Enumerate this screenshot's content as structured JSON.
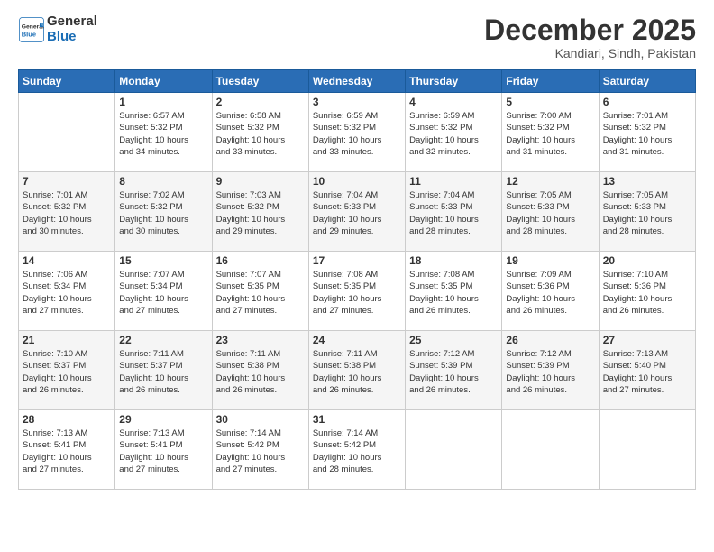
{
  "logo": {
    "line1": "General",
    "line2": "Blue"
  },
  "title": "December 2025",
  "location": "Kandiari, Sindh, Pakistan",
  "headers": [
    "Sunday",
    "Monday",
    "Tuesday",
    "Wednesday",
    "Thursday",
    "Friday",
    "Saturday"
  ],
  "weeks": [
    [
      {
        "day": "",
        "info": ""
      },
      {
        "day": "1",
        "info": "Sunrise: 6:57 AM\nSunset: 5:32 PM\nDaylight: 10 hours\nand 34 minutes."
      },
      {
        "day": "2",
        "info": "Sunrise: 6:58 AM\nSunset: 5:32 PM\nDaylight: 10 hours\nand 33 minutes."
      },
      {
        "day": "3",
        "info": "Sunrise: 6:59 AM\nSunset: 5:32 PM\nDaylight: 10 hours\nand 33 minutes."
      },
      {
        "day": "4",
        "info": "Sunrise: 6:59 AM\nSunset: 5:32 PM\nDaylight: 10 hours\nand 32 minutes."
      },
      {
        "day": "5",
        "info": "Sunrise: 7:00 AM\nSunset: 5:32 PM\nDaylight: 10 hours\nand 31 minutes."
      },
      {
        "day": "6",
        "info": "Sunrise: 7:01 AM\nSunset: 5:32 PM\nDaylight: 10 hours\nand 31 minutes."
      }
    ],
    [
      {
        "day": "7",
        "info": "Sunrise: 7:01 AM\nSunset: 5:32 PM\nDaylight: 10 hours\nand 30 minutes."
      },
      {
        "day": "8",
        "info": "Sunrise: 7:02 AM\nSunset: 5:32 PM\nDaylight: 10 hours\nand 30 minutes."
      },
      {
        "day": "9",
        "info": "Sunrise: 7:03 AM\nSunset: 5:32 PM\nDaylight: 10 hours\nand 29 minutes."
      },
      {
        "day": "10",
        "info": "Sunrise: 7:04 AM\nSunset: 5:33 PM\nDaylight: 10 hours\nand 29 minutes."
      },
      {
        "day": "11",
        "info": "Sunrise: 7:04 AM\nSunset: 5:33 PM\nDaylight: 10 hours\nand 28 minutes."
      },
      {
        "day": "12",
        "info": "Sunrise: 7:05 AM\nSunset: 5:33 PM\nDaylight: 10 hours\nand 28 minutes."
      },
      {
        "day": "13",
        "info": "Sunrise: 7:05 AM\nSunset: 5:33 PM\nDaylight: 10 hours\nand 28 minutes."
      }
    ],
    [
      {
        "day": "14",
        "info": "Sunrise: 7:06 AM\nSunset: 5:34 PM\nDaylight: 10 hours\nand 27 minutes."
      },
      {
        "day": "15",
        "info": "Sunrise: 7:07 AM\nSunset: 5:34 PM\nDaylight: 10 hours\nand 27 minutes."
      },
      {
        "day": "16",
        "info": "Sunrise: 7:07 AM\nSunset: 5:35 PM\nDaylight: 10 hours\nand 27 minutes."
      },
      {
        "day": "17",
        "info": "Sunrise: 7:08 AM\nSunset: 5:35 PM\nDaylight: 10 hours\nand 27 minutes."
      },
      {
        "day": "18",
        "info": "Sunrise: 7:08 AM\nSunset: 5:35 PM\nDaylight: 10 hours\nand 26 minutes."
      },
      {
        "day": "19",
        "info": "Sunrise: 7:09 AM\nSunset: 5:36 PM\nDaylight: 10 hours\nand 26 minutes."
      },
      {
        "day": "20",
        "info": "Sunrise: 7:10 AM\nSunset: 5:36 PM\nDaylight: 10 hours\nand 26 minutes."
      }
    ],
    [
      {
        "day": "21",
        "info": "Sunrise: 7:10 AM\nSunset: 5:37 PM\nDaylight: 10 hours\nand 26 minutes."
      },
      {
        "day": "22",
        "info": "Sunrise: 7:11 AM\nSunset: 5:37 PM\nDaylight: 10 hours\nand 26 minutes."
      },
      {
        "day": "23",
        "info": "Sunrise: 7:11 AM\nSunset: 5:38 PM\nDaylight: 10 hours\nand 26 minutes."
      },
      {
        "day": "24",
        "info": "Sunrise: 7:11 AM\nSunset: 5:38 PM\nDaylight: 10 hours\nand 26 minutes."
      },
      {
        "day": "25",
        "info": "Sunrise: 7:12 AM\nSunset: 5:39 PM\nDaylight: 10 hours\nand 26 minutes."
      },
      {
        "day": "26",
        "info": "Sunrise: 7:12 AM\nSunset: 5:39 PM\nDaylight: 10 hours\nand 26 minutes."
      },
      {
        "day": "27",
        "info": "Sunrise: 7:13 AM\nSunset: 5:40 PM\nDaylight: 10 hours\nand 27 minutes."
      }
    ],
    [
      {
        "day": "28",
        "info": "Sunrise: 7:13 AM\nSunset: 5:41 PM\nDaylight: 10 hours\nand 27 minutes."
      },
      {
        "day": "29",
        "info": "Sunrise: 7:13 AM\nSunset: 5:41 PM\nDaylight: 10 hours\nand 27 minutes."
      },
      {
        "day": "30",
        "info": "Sunrise: 7:14 AM\nSunset: 5:42 PM\nDaylight: 10 hours\nand 27 minutes."
      },
      {
        "day": "31",
        "info": "Sunrise: 7:14 AM\nSunset: 5:42 PM\nDaylight: 10 hours\nand 28 minutes."
      },
      {
        "day": "",
        "info": ""
      },
      {
        "day": "",
        "info": ""
      },
      {
        "day": "",
        "info": ""
      }
    ]
  ]
}
